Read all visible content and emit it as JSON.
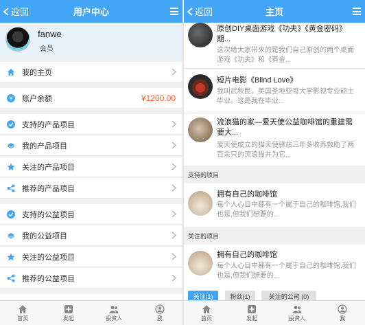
{
  "colors": {
    "header": "#42a5f5",
    "icon_blue": "#42a5f5",
    "amount": "#ff5722"
  },
  "left": {
    "back_label": "返回",
    "title": "用户中心",
    "profile": {
      "name": "fanwe",
      "role": "会员"
    },
    "menu": [
      {
        "label": "我的主页",
        "icon": "home-icon"
      },
      {
        "label": "账户余额",
        "icon": "yen-icon",
        "amount": "¥1200.00"
      },
      {
        "label": "支持的产品项目",
        "icon": "check-circle-icon"
      },
      {
        "label": "我的产品项目",
        "icon": "layers-icon"
      },
      {
        "label": "关注的产品项目",
        "icon": "star-icon"
      },
      {
        "label": "推荐的产品项目",
        "icon": "share-icon"
      },
      {
        "label": "支持的公益项目",
        "icon": "check-circle-icon"
      },
      {
        "label": "我的公益项目",
        "icon": "layers-icon"
      },
      {
        "label": "关注的公益项目",
        "icon": "star-icon"
      },
      {
        "label": "推荐的公益项目",
        "icon": "share-icon"
      }
    ],
    "tabbar": [
      "首页",
      "发起",
      "投资人",
      "我"
    ]
  },
  "right": {
    "back_label": "返回",
    "title": "主页",
    "items": [
      {
        "title": "原创DIY桌面游戏《功夫》《黄金密码》期...",
        "desc": "这次给大家带来的是我们自己原创的两个桌面游戏《功夫》和《黄金..."
      },
      {
        "title": "短片电影《Blind Love》",
        "desc": "我叫武秋民，美国圣地亚哥大学影视专业硕士毕业。这是我在毕业..."
      },
      {
        "title": "流浪猫的家—爱天使公益咖啡馆的重建需要大...",
        "desc": "爱天使成立的猫天使驿站三年多收养救助了两百余只的流浪猫并为它..."
      }
    ],
    "section_support": "支持的项目",
    "support_item": {
      "title": "拥有自己的咖啡馆",
      "desc": "每个人心目中都有一个属于自己的咖啡馆,我们也是,但我们想要的..."
    },
    "section_follow": "关注的项目",
    "follow_item": {
      "title": "拥有自己的咖啡馆",
      "desc": "每个人心目中都有一个属于自己的咖啡馆,我们也是,但我们想要的..."
    },
    "social_tabs": [
      "关注(1)",
      "粉丝(1)",
      "关注的公司 (0)"
    ],
    "tabbar": [
      "首页",
      "发起",
      "投资人",
      "我"
    ]
  }
}
